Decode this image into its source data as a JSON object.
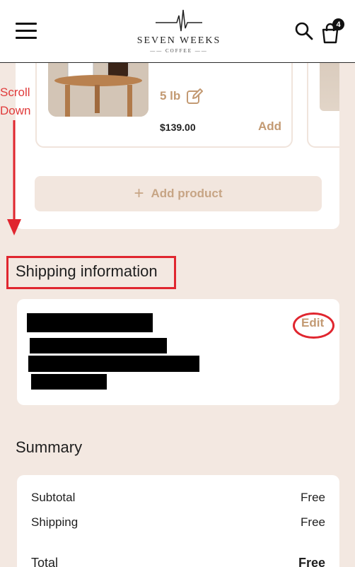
{
  "header": {
    "brand_name": "SEVEN WEEKS",
    "brand_sub": "COFFEE",
    "cart_count": "4"
  },
  "product": {
    "weight": "5 lb",
    "price": "$139.00",
    "add_label": "Add"
  },
  "add_product_label": "Add product",
  "annotation": {
    "scroll_note_line1": "Scroll",
    "scroll_note_line2": "Down",
    "color": "#e0262f"
  },
  "shipping": {
    "heading": "Shipping information",
    "edit_label": "Edit"
  },
  "summary": {
    "heading": "Summary",
    "rows": [
      {
        "label": "Subtotal",
        "value": "Free"
      },
      {
        "label": "Shipping",
        "value": "Free"
      }
    ],
    "total": {
      "label": "Total",
      "value": "Free"
    }
  },
  "colors": {
    "page_bg": "#f3e8e1",
    "accent": "#c39a73",
    "button_bg": "#f2e6de"
  }
}
